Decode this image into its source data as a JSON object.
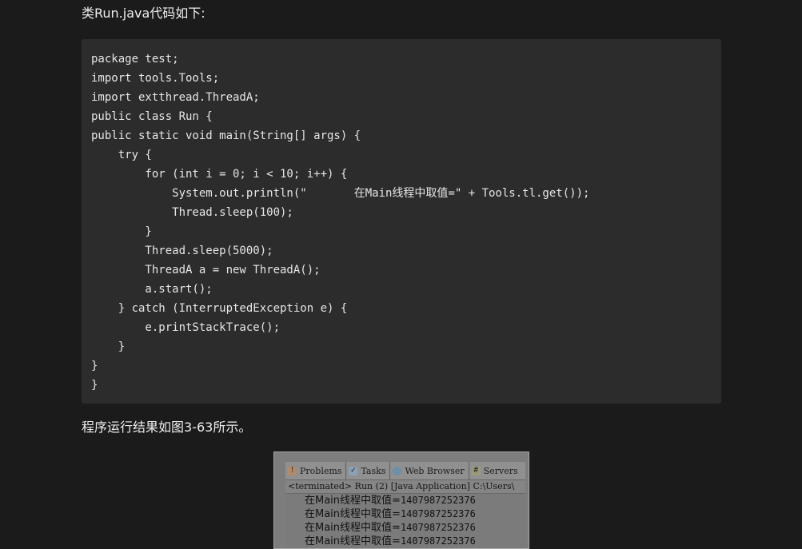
{
  "intro_text": "类Run.java代码如下:",
  "code_lines": [
    "package test;",
    "import tools.Tools;",
    "import extthread.ThreadA;",
    "public class Run {",
    "public static void main(String[] args) {",
    "    try {",
    "        for (int i = 0; i < 10; i++) {",
    "            System.out.println(\"       在Main线程中取值=\" + Tools.tl.get());",
    "            Thread.sleep(100);",
    "        }",
    "        Thread.sleep(5000);",
    "        ThreadA a = new ThreadA();",
    "        a.start();",
    "    } catch (InterruptedException e) {",
    "        e.printStackTrace();",
    "    }",
    "}",
    "}"
  ],
  "result_text": "程序运行结果如图3-63所示。",
  "console_screenshot": {
    "tabs": [
      {
        "label": "Problems",
        "icon": "problems-icon"
      },
      {
        "label": "Tasks",
        "icon": "tasks-icon"
      },
      {
        "label": "Web Browser",
        "icon": "web-browser-icon"
      },
      {
        "label": "Servers",
        "icon": "servers-icon"
      }
    ],
    "status_line": "<terminated> Run (2) [Java Application] C:\\Users\\",
    "output_prefix": "在Main线程中取值=",
    "output_value": "1407987252376",
    "output_lines_visible": 4
  }
}
